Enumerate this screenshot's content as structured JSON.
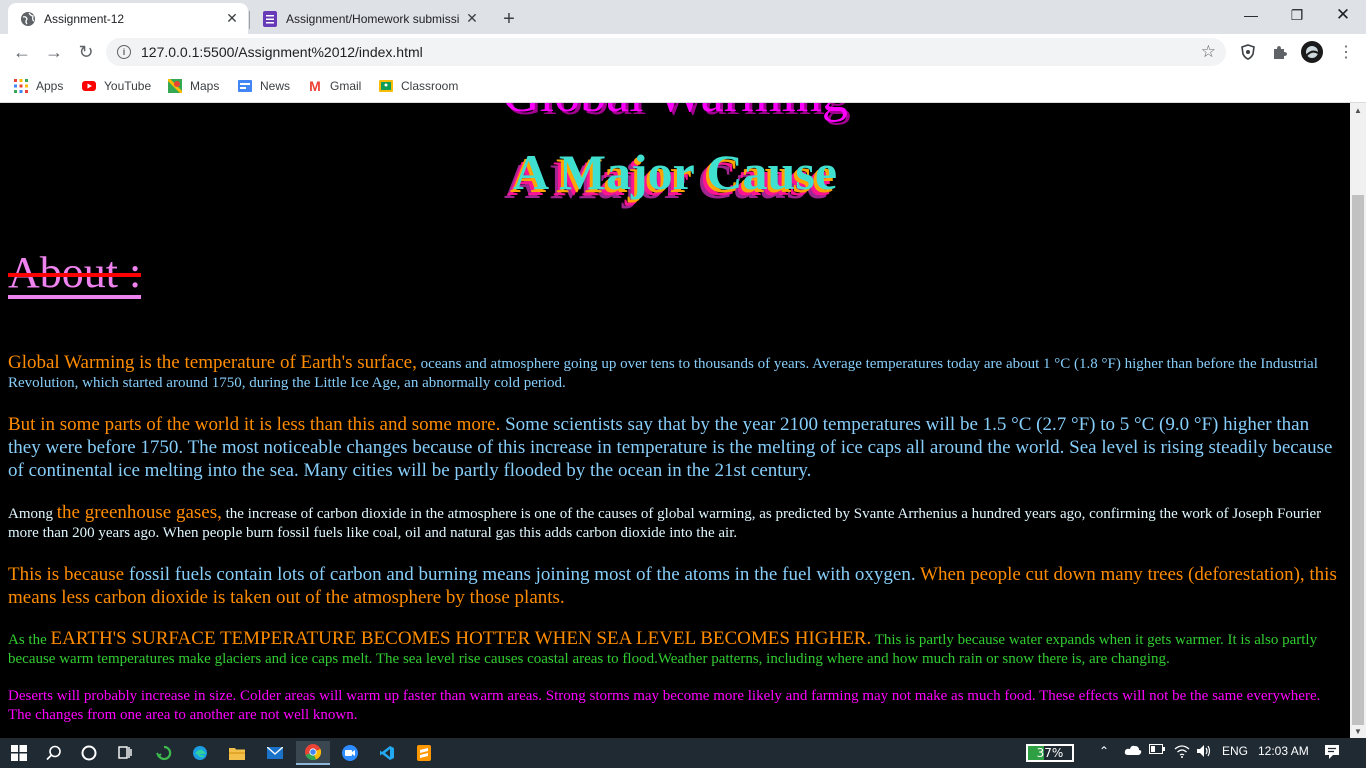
{
  "browser": {
    "tabs": [
      {
        "title": "Assignment-12",
        "icon": "globe-icon",
        "active": true
      },
      {
        "title": "Assignment/Homework submissi",
        "icon": "forms-icon",
        "active": false
      }
    ],
    "url": "127.0.0.1:5500/Assignment%2012/index.html",
    "bookmarks": [
      "Apps",
      "YouTube",
      "Maps",
      "News",
      "Gmail",
      "Classroom"
    ]
  },
  "page": {
    "title": "Global Warming",
    "subtitle": "A Major Cause",
    "about_heading": "About :",
    "p1_lead": "Global Warming is the temperature of Earth's surface,",
    "p1_rest": " oceans and atmosphere going up over tens to thousands of years. Average temperatures today are about 1 °C (1.8 °F) higher than before the Industrial Revolution, which started around 1750, during the Little Ice Age, an abnormally cold period.",
    "p2_a": "But in some parts of the world it is less than this and some more.",
    "p2_b": " Some scientists say that by the year 2100 temperatures will be 1.5 °C (2.7 °F) to 5 °C (9.0 °F) higher than they were before 1750.",
    "p2_c": " The most noticeable changes because of this increase in temperature is the melting of ice caps all around the world.",
    "p2_d": " Sea level is rising steadily because of continental ice melting into the sea. Many cities will be partly flooded by the ocean in the 21st century.",
    "p3_a": "Among ",
    "p3_b": "the greenhouse gases,",
    "p3_c": " the increase of carbon dioxide in the atmosphere is one of the causes of global warming, as predicted by Svante Arrhenius a hundred years ago, confirming the work of Joseph Fourier more than 200 years ago. When people burn fossil fuels like coal, oil and natural gas this adds carbon dioxide into the air.",
    "p4_a": "This is because",
    "p4_b": " fossil fuels contain lots of carbon and burning means joining most of the atoms in the fuel with oxygen.",
    "p4_c": " When people cut down many trees (deforestation), this means less carbon dioxide is taken out of the atmosphere by those plants.",
    "p5_a": "As the ",
    "p5_b": "EARTH'S SURFACE TEMPERATURE BECOMES HOTTER WHEN SEA LEVEL BECOMES HIGHER.",
    "p5_c": " This is partly because water expands when it gets warmer. It is also partly because warm temperatures make glaciers and ice caps melt. The sea level rise causes coastal areas to flood.Weather patterns, including where and how much rain or snow there is, are changing.",
    "p6": "Deserts will probably increase in size. Colder areas will warm up faster than warm areas. Strong storms may become more likely and farming may not make as much food. These effects will not be the same everywhere. The changes from one area to another are not well known."
  },
  "taskbar": {
    "battery": "37%",
    "battery_level": 0.37,
    "language": "ENG",
    "time": "12:03 AM"
  },
  "colors": {
    "accent_magenta": "#ff00ff",
    "accent_orange": "#ff8c00",
    "accent_blue": "#87cefa",
    "accent_green": "#32cd32"
  }
}
